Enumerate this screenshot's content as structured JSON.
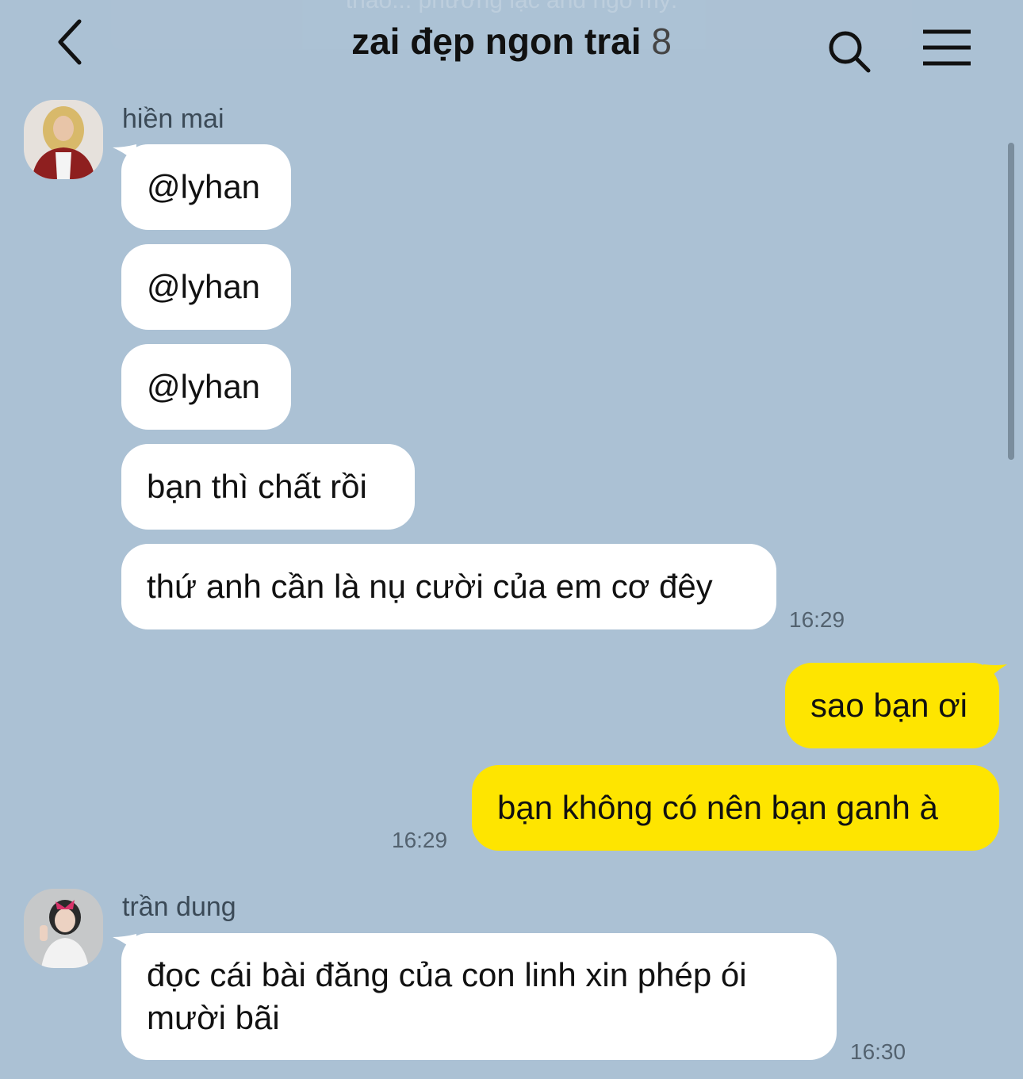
{
  "header": {
    "title": "zai đẹp ngon trai",
    "member_count": "8",
    "ghost_text": "thảo... phương lạc and ngồ mỹ."
  },
  "icons": {
    "back": "chevron-left-icon",
    "search": "search-icon",
    "menu": "hamburger-menu-icon"
  },
  "colors": {
    "background": "#abc1d4",
    "incoming_bubble": "#ffffff",
    "outgoing_bubble": "#fee500"
  },
  "messages": {
    "group1": {
      "sender": "hiền mai",
      "lines": [
        "@lyhan",
        "@lyhan",
        "@lyhan",
        "bạn thì chất rồi",
        "thứ anh cần là nụ cười của em cơ đêy"
      ],
      "time": "16:29"
    },
    "group2": {
      "lines": [
        "sao bạn ơi",
        "bạn không có nên bạn ganh à"
      ],
      "time": "16:29"
    },
    "group3": {
      "sender": "trần dung",
      "lines": [
        "đọc cái bài đăng của con linh xin phép ói mười bãi"
      ],
      "time": "16:30"
    }
  }
}
